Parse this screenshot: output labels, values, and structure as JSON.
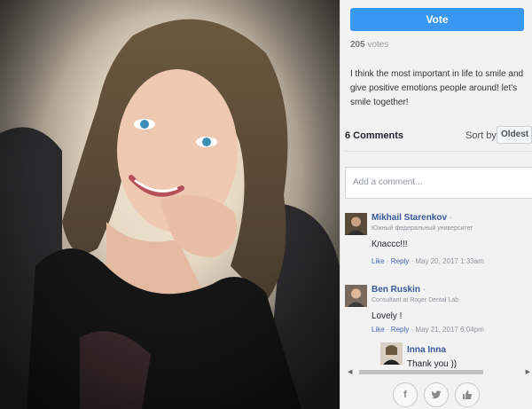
{
  "photo": {
    "alt_icon": "portrait-photo"
  },
  "panel": {
    "vote_label": "Vote",
    "votes_count": "205",
    "votes_suffix": "votes",
    "description": "I think the most important in life to smile and give positive emotions people around! let's smile together!",
    "comments_count_label": "6 Comments",
    "sort_label": "Sort by",
    "sort_value": "Oldest",
    "comment_placeholder": "Add a comment..."
  },
  "comments": [
    {
      "name": "Mikhail Starenkov",
      "subtitle": "Южный федеральный университет",
      "text": "Классс!!!",
      "like": "Like",
      "reply": "Reply",
      "date": "May 20, 2017 1:33am"
    },
    {
      "name": "Ben Ruskin",
      "subtitle": "Consultant at Roger Dental Lab",
      "text": "Lovely !",
      "like": "Like",
      "reply": "Reply",
      "date": "May 21, 2017 6:04pm"
    }
  ],
  "replies": [
    {
      "name": "Inna Inna",
      "text": "Thank you ))"
    }
  ],
  "share": {
    "facebook": "f",
    "twitter": "twitter-icon",
    "like": "thumbs-up-icon"
  },
  "colors": {
    "accent": "#3897f0",
    "link": "#4267b2",
    "name": "#365899"
  }
}
